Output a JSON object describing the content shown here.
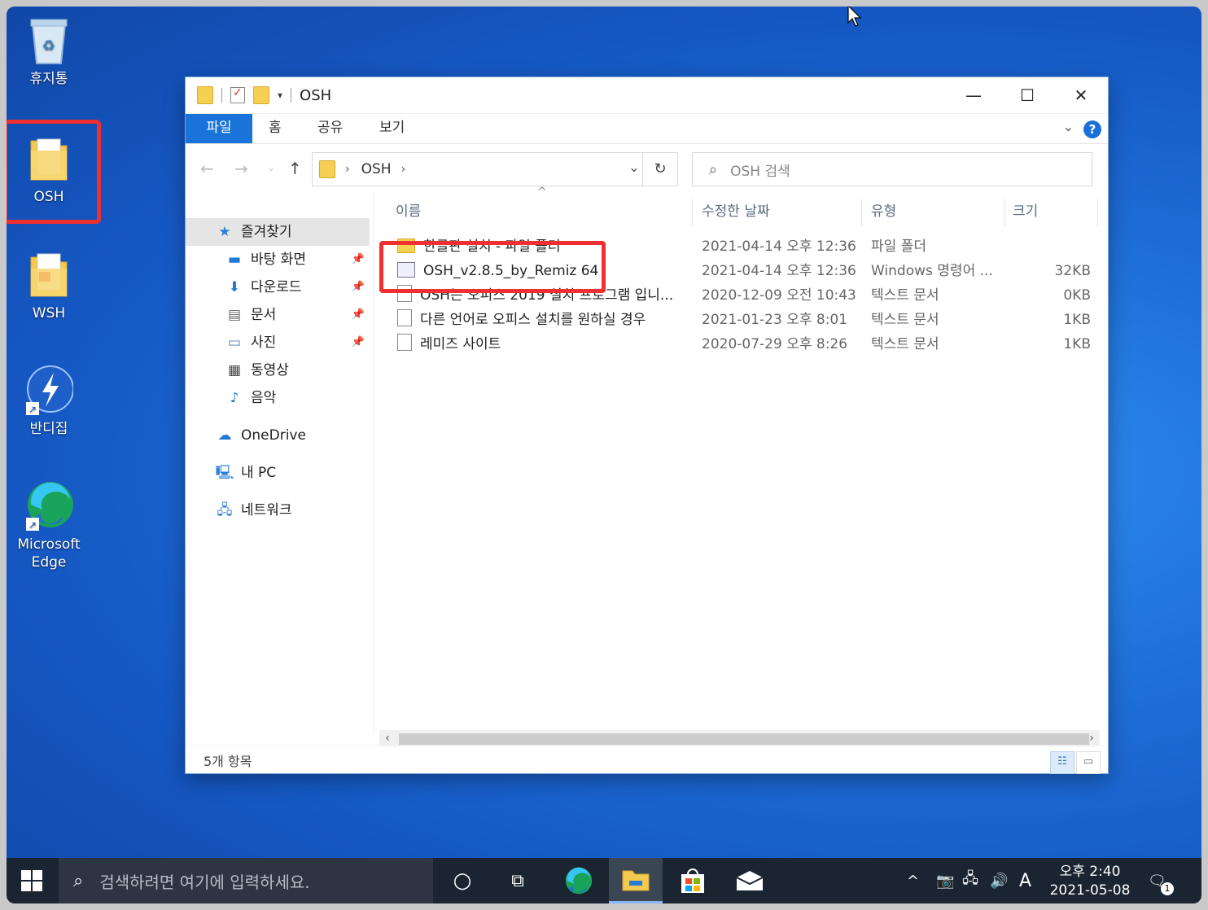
{
  "desktop": {
    "icons": [
      {
        "label": "휴지통",
        "icon": "recycle-bin-icon"
      },
      {
        "label": "OSH",
        "icon": "folder-icon"
      },
      {
        "label": "WSH",
        "icon": "folder-pdf-icon"
      },
      {
        "label": "반디집",
        "icon": "bandizip-icon"
      },
      {
        "label_line1": "Microsoft",
        "label_line2": "Edge",
        "icon": "edge-icon"
      }
    ]
  },
  "window": {
    "title": "OSH",
    "ribbon_tabs": [
      "파일",
      "홈",
      "공유",
      "보기"
    ],
    "address": {
      "crumb": "OSH"
    },
    "search": {
      "placeholder": "OSH 검색"
    },
    "nav": {
      "quick_access": "즐겨찾기",
      "items": [
        "바탕 화면",
        "다운로드",
        "문서",
        "사진",
        "동영상",
        "음악"
      ],
      "onedrive": "OneDrive",
      "pc": "내 PC",
      "network": "네트워크"
    },
    "columns": {
      "name": "이름",
      "date": "수정한 날짜",
      "type": "유형",
      "size": "크기"
    },
    "files": [
      {
        "name": "한글판 설치 - 파일 폴더",
        "date": "2021-04-14 오후 12:36",
        "type": "파일 폴더",
        "size": "",
        "kind": "folder"
      },
      {
        "name": "OSH_v2.8.5_by_Remiz 64",
        "date": "2021-04-14 오후 12:36",
        "type": "Windows 명령어 ...",
        "size": "32KB",
        "kind": "cmd"
      },
      {
        "name": "OSH는 오피스 2019 설치 프로그램 입니...",
        "date": "2020-12-09 오전 10:43",
        "type": "텍스트 문서",
        "size": "0KB",
        "kind": "txt"
      },
      {
        "name": "다른 언어로 오피스 설치를 원하실 경우",
        "date": "2021-01-23 오후 8:01",
        "type": "텍스트 문서",
        "size": "1KB",
        "kind": "txt"
      },
      {
        "name": "레미즈 사이트",
        "date": "2020-07-29 오후 8:26",
        "type": "텍스트 문서",
        "size": "1KB",
        "kind": "txt"
      }
    ],
    "status": "5개 항목"
  },
  "taskbar": {
    "search_placeholder": "검색하려면 여기에 입력하세요.",
    "ime": "A",
    "time": "오후 2:40",
    "date": "2021-05-08",
    "notification_count": "1"
  },
  "colors": {
    "accent": "#1a73d9",
    "highlight": "#ef3030",
    "taskbar": "#1b2431"
  }
}
